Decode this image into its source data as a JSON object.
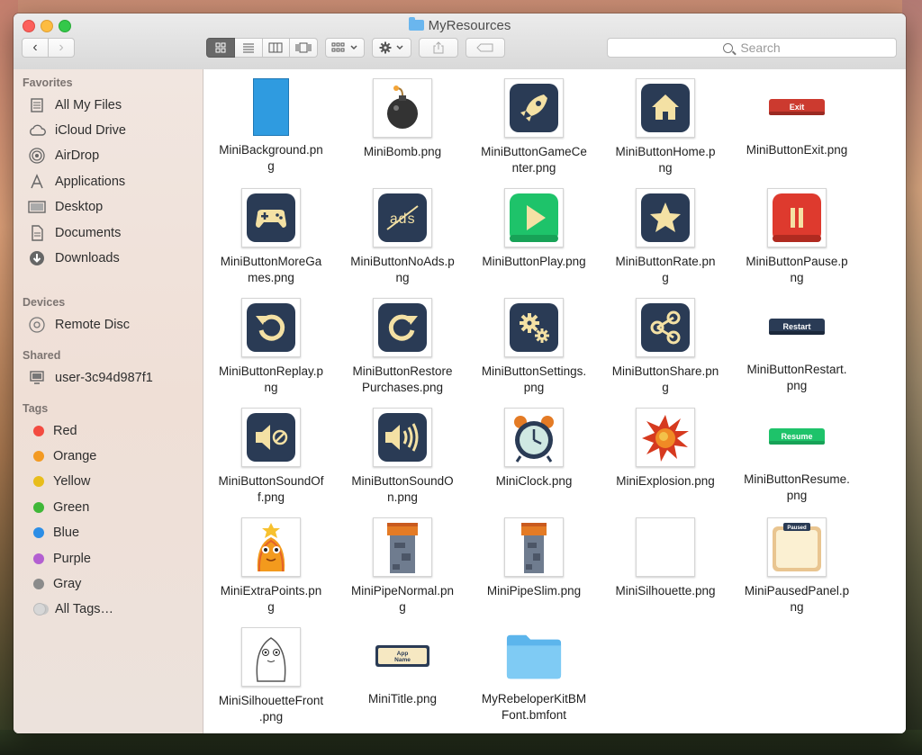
{
  "window": {
    "title": "MyResources"
  },
  "toolbar": {
    "back_glyph": "‹",
    "forward_glyph": "›",
    "search_placeholder": "Search"
  },
  "sidebar": {
    "favorites_header": "Favorites",
    "favorites": [
      "All My Files",
      "iCloud Drive",
      "AirDrop",
      "Applications",
      "Desktop",
      "Documents",
      "Downloads"
    ],
    "devices_header": "Devices",
    "devices": [
      "Remote Disc"
    ],
    "shared_header": "Shared",
    "shared": [
      "user-3c94d987f1"
    ],
    "tags_header": "Tags",
    "tags": [
      {
        "label": "Red",
        "color": "#f34b40"
      },
      {
        "label": "Orange",
        "color": "#f39a22"
      },
      {
        "label": "Yellow",
        "color": "#e8bd1b"
      },
      {
        "label": "Green",
        "color": "#3fb738"
      },
      {
        "label": "Blue",
        "color": "#2c8ee6"
      },
      {
        "label": "Purple",
        "color": "#b35fd1"
      },
      {
        "label": "Gray",
        "color": "#8b8b8b"
      }
    ],
    "all_tags": "All Tags…"
  },
  "files": [
    {
      "name": "MiniBackground.png",
      "line1": "MiniBackground.pn",
      "line2": "g",
      "icon": "background-icon"
    },
    {
      "name": "MiniBomb.png",
      "line1": "MiniBomb.png",
      "line2": "",
      "icon": "bomb-icon"
    },
    {
      "name": "MiniButtonGameCenter.png",
      "line1": "MiniButtonGameCe",
      "line2": "nter.png",
      "icon": "rocket-icon"
    },
    {
      "name": "MiniButtonHome.png",
      "line1": "MiniButtonHome.p",
      "line2": "ng",
      "icon": "home-icon"
    },
    {
      "name": "MiniButtonExit.png",
      "line1": "MiniButtonExit.png",
      "line2": "",
      "icon": "exit-icon",
      "label": "Exit"
    },
    {
      "name": "MiniButtonMoreGames.png",
      "line1": "MiniButtonMoreGa",
      "line2": "mes.png",
      "icon": "gamepad-icon"
    },
    {
      "name": "MiniButtonNoAds.png",
      "line1": "MiniButtonNoAds.p",
      "line2": "ng",
      "icon": "noads-icon",
      "label": "ads"
    },
    {
      "name": "MiniButtonPlay.png",
      "line1": "MiniButtonPlay.png",
      "line2": "",
      "icon": "play-icon"
    },
    {
      "name": "MiniButtonRate.png",
      "line1": "MiniButtonRate.pn",
      "line2": "g",
      "icon": "star-icon"
    },
    {
      "name": "MiniButtonPause.png",
      "line1": "MiniButtonPause.p",
      "line2": "ng",
      "icon": "pause-icon"
    },
    {
      "name": "MiniButtonReplay.png",
      "line1": "MiniButtonReplay.p",
      "line2": "ng",
      "icon": "replay-icon"
    },
    {
      "name": "MiniButtonRestorePurchases.png",
      "line1": "MiniButtonRestore",
      "line2": "Purchases.png",
      "icon": "restore-icon"
    },
    {
      "name": "MiniButtonSettings.png",
      "line1": "MiniButtonSettings.",
      "line2": "png",
      "icon": "gears-icon"
    },
    {
      "name": "MiniButtonShare.png",
      "line1": "MiniButtonShare.pn",
      "line2": "g",
      "icon": "share-icon"
    },
    {
      "name": "MiniButtonRestart.png",
      "line1": "MiniButtonRestart.",
      "line2": "png",
      "icon": "restart-icon",
      "label": "Restart"
    },
    {
      "name": "MiniButtonSoundOff.png",
      "line1": "MiniButtonSoundOf",
      "line2": "f.png",
      "icon": "sound-off-icon"
    },
    {
      "name": "MiniButtonSoundOn.png",
      "line1": "MiniButtonSoundO",
      "line2": "n.png",
      "icon": "sound-on-icon"
    },
    {
      "name": "MiniClock.png",
      "line1": "MiniClock.png",
      "line2": "",
      "icon": "clock-icon"
    },
    {
      "name": "MiniExplosion.png",
      "line1": "MiniExplosion.png",
      "line2": "",
      "icon": "explosion-icon"
    },
    {
      "name": "MiniButtonResume.png",
      "line1": "MiniButtonResume.",
      "line2": "png",
      "icon": "resume-icon",
      "label": "Resume"
    },
    {
      "name": "MiniExtraPoints.png",
      "line1": "MiniExtraPoints.pn",
      "line2": "g",
      "icon": "character-icon"
    },
    {
      "name": "MiniPipeNormal.png",
      "line1": "MiniPipeNormal.pn",
      "line2": "g",
      "icon": "tower-icon"
    },
    {
      "name": "MiniPipeSlim.png",
      "line1": "MiniPipeSlim.png",
      "line2": "",
      "icon": "tower-slim-icon"
    },
    {
      "name": "MiniSilhouette.png",
      "line1": "MiniSilhouette.png",
      "line2": "",
      "icon": "blank-icon"
    },
    {
      "name": "MiniPausedPanel.png",
      "line1": "MiniPausedPanel.p",
      "line2": "ng",
      "icon": "paused-panel-icon",
      "label": "Paused"
    },
    {
      "name": "MiniSilhouetteFront.png",
      "line1": "MiniSilhouetteFront",
      "line2": ".png",
      "icon": "silhouette-icon"
    },
    {
      "name": "MiniTitle.png",
      "line1": "MiniTitle.png",
      "line2": "",
      "icon": "title-banner-icon",
      "label": "App Name"
    },
    {
      "name": "MyRebeloperKitBMFont.bmfont",
      "line1": "MyRebeloperKitBM",
      "line2": "Font.bmfont",
      "icon": "folder-icon"
    }
  ]
}
